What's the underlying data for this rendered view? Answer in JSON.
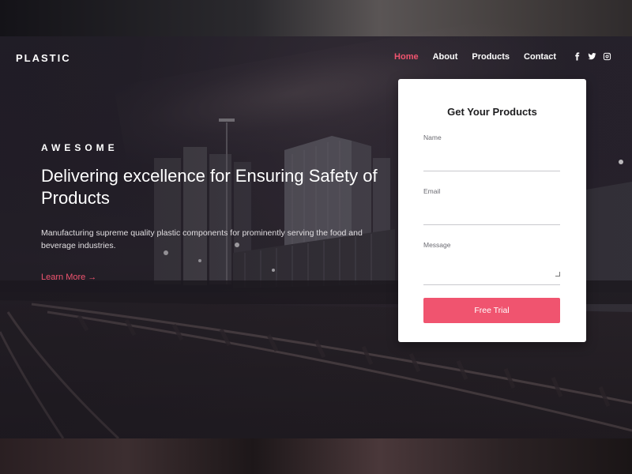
{
  "header": {
    "brand": "PLASTIC",
    "nav": [
      {
        "label": "Home",
        "active": true
      },
      {
        "label": "About",
        "active": false
      },
      {
        "label": "Products",
        "active": false
      },
      {
        "label": "Contact",
        "active": false
      }
    ],
    "social_icons": [
      "facebook-icon",
      "twitter-icon",
      "instagram-icon"
    ]
  },
  "hero": {
    "eyebrow": "AWESOME",
    "headline": "Delivering excellence for Ensuring Safety of Products",
    "description": "Manufacturing supreme quality plastic components for prominently serving the food and beverage industries.",
    "cta_label": "Learn More",
    "cta_icon": "arrow-right-icon"
  },
  "form": {
    "title": "Get Your Products",
    "fields": {
      "name": {
        "label": "Name",
        "value": ""
      },
      "email": {
        "label": "Email",
        "value": ""
      },
      "message": {
        "label": "Message",
        "value": ""
      }
    },
    "submit_label": "Free Trial"
  },
  "colors": {
    "accent": "#f0546f",
    "card_bg": "#ffffff",
    "text_light": "#ffffff"
  }
}
